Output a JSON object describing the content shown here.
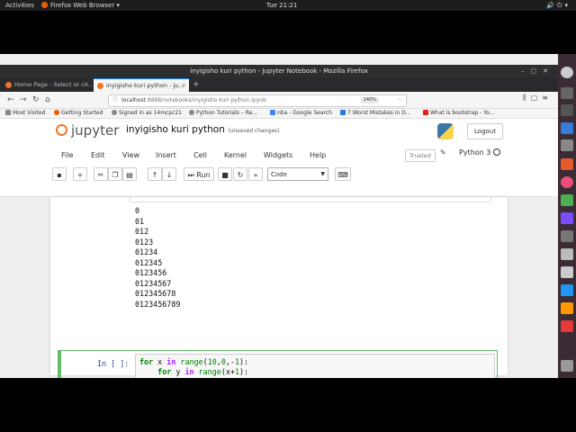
{
  "os_bar": {
    "activities": "Activities",
    "app": "Firefox Web Browser",
    "clock": "Tue 21:21"
  },
  "window": {
    "title": "inyigisho kuri python - Jupyter Notebook - Mozilla Firefox"
  },
  "tabs": [
    {
      "label": "Home Page - Select or cr..."
    },
    {
      "label": "inyigisho kuri python - Ju..."
    }
  ],
  "nav": {
    "url_host": "localhost",
    "url_rest": ":8888/notebooks/inyigisho kuri python.ipynb",
    "zoom": "140%"
  },
  "bookmarks": [
    "Most Visited",
    "Getting Started",
    "Signed in as 14mcpc21",
    "Python Tutorials – Re...",
    "nba - Google Search",
    "7 Worst Mistakes in D...",
    "What is bootstrap - Yo..."
  ],
  "jupyter": {
    "logo_text": "jupyter",
    "notebook_name": "inyigisho kuri python",
    "save_status": "(unsaved changes)",
    "logout": "Logout",
    "trusted": "Trusted",
    "kernel": "Python 3",
    "menu": [
      "File",
      "Edit",
      "View",
      "Insert",
      "Cell",
      "Kernel",
      "Widgets",
      "Help"
    ],
    "run_label": "Run",
    "cell_type": "Code"
  },
  "output_lines": "0\n01\n012\n0123\n01234\n012345\n0123456\n01234567\n012345678\n0123456789",
  "cell": {
    "prompt": "In [ ]:"
  },
  "colors": {
    "jupyter_orange": "#f37626",
    "cell_border_green": "#66bb6a",
    "prompt_blue": "#303f9f"
  }
}
